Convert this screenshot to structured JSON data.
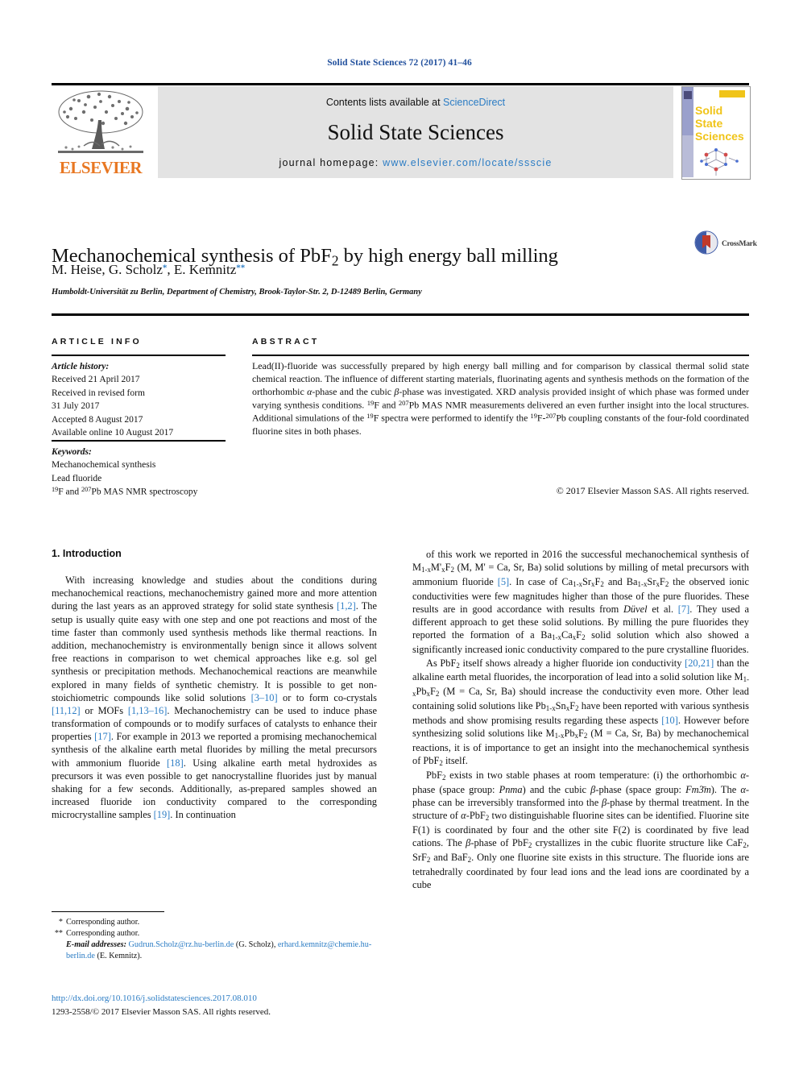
{
  "running_head": "Solid State Sciences 72 (2017) 41–46",
  "masthead": {
    "contents_prefix": "Contents lists available at ",
    "sciencedirect": "ScienceDirect",
    "journal_name": "Solid State Sciences",
    "homepage_prefix": "journal homepage: ",
    "homepage_url": "www.elsevier.com/locate/ssscie",
    "publisher": "ELSEVIER",
    "cover_title_lines": [
      "Solid",
      "State",
      "Sciences"
    ]
  },
  "article": {
    "title_html": "Mechanochemical synthesis of PbF<sub>2</sub> by high energy ball milling",
    "authors_html": "M. Heise, G. Scholz<sup>*</sup>, E. Kemnitz<sup>**</sup>",
    "affiliation": "Humboldt-Universität zu Berlin, Department of Chemistry, Brook-Taylor-Str. 2, D-12489 Berlin, Germany",
    "crossmark_label": "CrossMark"
  },
  "info": {
    "heading": "ARTICLE INFO",
    "history_label": "Article history:",
    "history_lines": [
      "Received 21 April 2017",
      "Received in revised form",
      "31 July 2017",
      "Accepted 8 August 2017",
      "Available online 10 August 2017"
    ],
    "keywords_label": "Keywords:",
    "keywords_html": "Mechanochemical synthesis<br>Lead fluoride<br><sup>19</sup>F and <sup>207</sup>Pb MAS NMR spectroscopy"
  },
  "abstract": {
    "heading": "ABSTRACT",
    "body_html": "Lead(II)-fluoride was successfully prepared by high energy ball milling and for comparison by classical thermal solid state chemical reaction. The influence of different starting materials, fluorinating agents and synthesis methods on the formation of the orthorhombic <span class=\"ital\">α</span>-phase and the cubic <span class=\"ital\">β</span>-phase was investigated. XRD analysis provided insight of which phase was formed under varying synthesis conditions. <sup>19</sup>F and <sup>207</sup>Pb MAS NMR measurements delivered an even further insight into the local structures. Additional simulations of the <sup>19</sup>F spectra were performed to identify the <sup>19</sup>F-<sup>207</sup>Pb coupling constants of the four-fold coordinated fluorine sites in both phases.",
    "copyright": "© 2017 Elsevier Masson SAS. All rights reserved."
  },
  "body": {
    "section_title": "1. Introduction",
    "left_paragraphs_html": [
      "With increasing knowledge and studies about the conditions during mechanochemical reactions, mechanochemistry gained more and more attention during the last years as an approved strategy for solid state synthesis <span class=\"ref\">[1,2]</span>. The setup is usually quite easy with one step and one pot reactions and most of the time faster than commonly used synthesis methods like thermal reactions. In addition, mechanochemistry is environmentally benign since it allows solvent free reactions in comparison to wet chemical approaches like e.g. sol gel synthesis or precipitation methods. Mechanochemical reactions are meanwhile explored in many fields of synthetic chemistry. It is possible to get non-stoichiometric compounds like solid solutions <span class=\"ref\">[3–10]</span> or to form co-crystals <span class=\"ref\">[11,12]</span> or MOFs <span class=\"ref\">[1,13–16]</span>. Mechanochemistry can be used to induce phase transformation of compounds or to modify surfaces of catalysts to enhance their properties <span class=\"ref\">[17]</span>. For example in 2013 we reported a promising mechanochemical synthesis of the alkaline earth metal fluorides by milling the metal precursors with ammonium fluoride <span class=\"ref\">[18]</span>. Using alkaline earth metal hydroxides as precursors it was even possible to get nanocrystalline fluorides just by manual shaking for a few seconds. Additionally, as-prepared samples showed an increased fluoride ion conductivity compared to the corresponding microcrystalline samples <span class=\"ref\">[19]</span>. In continuation"
    ],
    "right_paragraphs_html": [
      "of this work we reported in 2016 the successful mechanochemical synthesis of M<sub>1-x</sub>M'<sub>x</sub>F<sub>2</sub> (M, M' = Ca, Sr, Ba) solid solutions by milling of metal precursors with ammonium fluoride <span class=\"ref\">[5]</span>. In case of Ca<sub>1-x</sub>Sr<sub>x</sub>F<sub>2</sub> and Ba<sub>1-x</sub>Sr<sub>x</sub>F<sub>2</sub> the observed ionic conductivities were few magnitudes higher than those of the pure fluorides. These results are in good accordance with results from <span class=\"ital\">Düvel</span> et al. <span class=\"ref\">[7]</span>. They used a different approach to get these solid solutions. By milling the pure fluorides they reported the formation of a Ba<sub>1-x</sub>Ca<sub>x</sub>F<sub>2</sub> solid solution which also showed a significantly increased ionic conductivity compared to the pure crystalline fluorides.",
      "As PbF<sub>2</sub> itself shows already a higher fluoride ion conductivity <span class=\"ref\">[20,21]</span> than the alkaline earth metal fluorides, the incorporation of lead into a solid solution like M<sub>1-x</sub>Pb<sub>x</sub>F<sub>2</sub> (M = Ca, Sr, Ba) should increase the conductivity even more. Other lead containing solid solutions like Pb<sub>1-x</sub>Sn<sub>x</sub>F<sub>2</sub> have been reported with various synthesis methods and show promising results regarding these aspects <span class=\"ref\">[10]</span>. However before synthesizing solid solutions like M<sub>1-x</sub>Pb<sub>x</sub>F<sub>2</sub> (M = Ca, Sr, Ba) by mechanochemical reactions, it is of importance to get an insight into the mechanochemical synthesis of PbF<sub>2</sub> itself.",
      "PbF<sub>2</sub> exists in two stable phases at room temperature: (i) the orthorhombic <span class=\"ital\">α</span>-phase (space group: <span class=\"ital\">Pnma</span>) and the cubic <span class=\"ital\">β</span>-phase (space group: <span class=\"ital\">Fm3̄m</span>). The <span class=\"ital\">α</span>-phase can be irreversibly transformed into the <span class=\"ital\">β</span>-phase by thermal treatment. In the structure of <span class=\"ital\">α</span>-PbF<sub>2</sub> two distinguishable fluorine sites can be identified. Fluorine site F(1) is coordinated by four and the other site F(2) is coordinated by five lead cations. The <span class=\"ital\">β</span>-phase of PbF<sub>2</sub> crystallizes in the cubic fluorite structure like CaF<sub>2</sub>, SrF<sub>2</sub> and BaF<sub>2</sub>. Only one fluorine site exists in this structure. The fluoride ions are tetrahedrally coordinated by four lead ions and the lead ions are coordinated by a cube"
    ]
  },
  "footnotes": {
    "line1": "Corresponding author.",
    "line2": "Corresponding author.",
    "email_label": "E-mail addresses:",
    "email1": "Gudrun.Scholz@rz.hu-berlin.de",
    "email1_name": "(G. Scholz)",
    "email2": "erhard.kemnitz@chemie.hu-berlin.de",
    "email2_name": "(E. Kemnitz)",
    "doi": "http://dx.doi.org/10.1016/j.solidstatesciences.2017.08.010",
    "issn": "1293-2558/© 2017 Elsevier Masson SAS. All rights reserved."
  },
  "colors": {
    "link": "#2b7cc4",
    "running_head": "#1f4e9c",
    "elsevier_orange": "#E87722",
    "mast_bg": "#e3e3e3"
  }
}
